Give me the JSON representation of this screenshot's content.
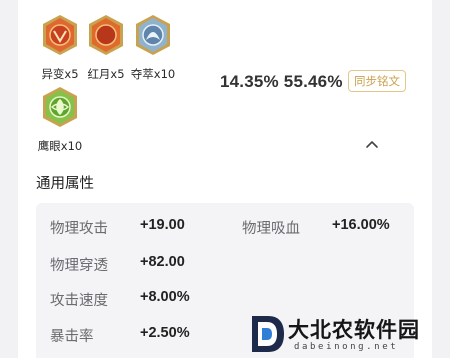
{
  "runes": [
    {
      "icon": "rune-yibian-icon",
      "label": "异变x5"
    },
    {
      "icon": "rune-hongyue-icon",
      "label": "红月x5"
    },
    {
      "icon": "rune-duocui-icon",
      "label": "夺萃x10"
    },
    {
      "icon": "rune-yingyan-icon",
      "label": "鹰眼x10"
    }
  ],
  "summary": {
    "percent_a": "14.35%",
    "percent_b": "55.46%",
    "sync_button": "同步铭文"
  },
  "section_title": "通用属性",
  "attributes": [
    {
      "name": "物理攻击",
      "value": "+19.00"
    },
    {
      "name": "物理吸血",
      "value": "+16.00%"
    },
    {
      "name": "物理穿透",
      "value": "+82.00"
    },
    {
      "name": "攻击速度",
      "value": "+8.00%"
    },
    {
      "name": "暴击率",
      "value": "+2.50%"
    }
  ],
  "watermark": {
    "text": "大北农软件园",
    "url": "dabeinong.net"
  },
  "colors": {
    "accent_gold": "#c9a24f",
    "rune_red": "#d9532b",
    "rune_blue": "#7fa8c9",
    "rune_green": "#7bbf3a"
  }
}
